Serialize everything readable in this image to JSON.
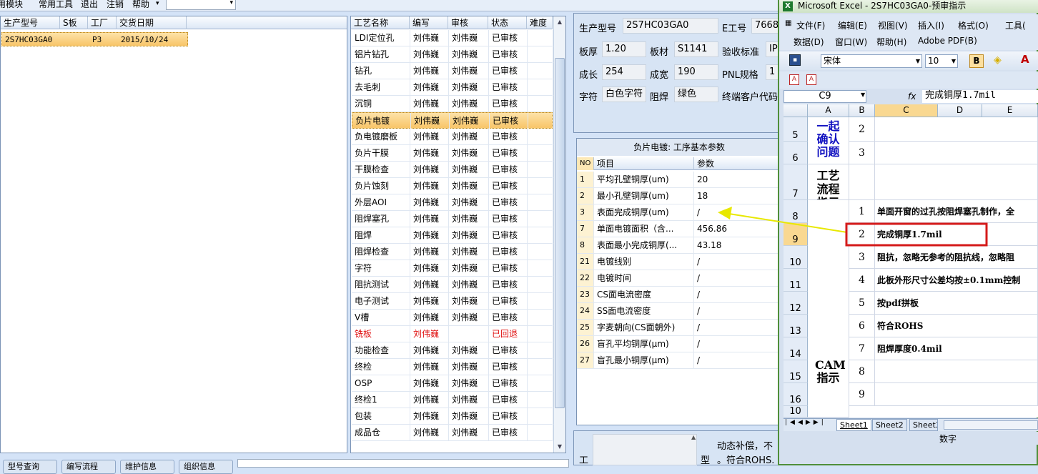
{
  "menu": {
    "items": [
      "共用模块",
      "常用工具",
      "退出",
      "注销",
      "帮助"
    ],
    "dropdown_arrow": "▾"
  },
  "products": {
    "headers": [
      "生产型号",
      "S板",
      "工厂",
      "交货日期"
    ],
    "rows": [
      {
        "model": "2S7HC03GA0",
        "s": "",
        "factory": "P3",
        "date": "2015/10/24"
      }
    ]
  },
  "process": {
    "headers": [
      "工艺名称",
      "编写",
      "审核",
      "状态",
      "难度"
    ],
    "rows": [
      {
        "name": "LDI定位孔",
        "writer": "刘伟巍",
        "reviewer": "刘伟巍",
        "status": "已审核"
      },
      {
        "name": "铝片钻孔",
        "writer": "刘伟巍",
        "reviewer": "刘伟巍",
        "status": "已审核"
      },
      {
        "name": "钻孔",
        "writer": "刘伟巍",
        "reviewer": "刘伟巍",
        "status": "已审核"
      },
      {
        "name": "去毛刺",
        "writer": "刘伟巍",
        "reviewer": "刘伟巍",
        "status": "已审核"
      },
      {
        "name": "沉铜",
        "writer": "刘伟巍",
        "reviewer": "刘伟巍",
        "status": "已审核"
      },
      {
        "name": "负片电镀",
        "writer": "刘伟巍",
        "reviewer": "刘伟巍",
        "status": "已审核"
      },
      {
        "name": "负电镀磨板",
        "writer": "刘伟巍",
        "reviewer": "刘伟巍",
        "status": "已审核"
      },
      {
        "name": "负片干膜",
        "writer": "刘伟巍",
        "reviewer": "刘伟巍",
        "status": "已审核"
      },
      {
        "name": "干膜检查",
        "writer": "刘伟巍",
        "reviewer": "刘伟巍",
        "status": "已审核"
      },
      {
        "name": "负片蚀刻",
        "writer": "刘伟巍",
        "reviewer": "刘伟巍",
        "status": "已审核"
      },
      {
        "name": "外层AOI",
        "writer": "刘伟巍",
        "reviewer": "刘伟巍",
        "status": "已审核"
      },
      {
        "name": "阻焊塞孔",
        "writer": "刘伟巍",
        "reviewer": "刘伟巍",
        "status": "已审核"
      },
      {
        "name": "阻焊",
        "writer": "刘伟巍",
        "reviewer": "刘伟巍",
        "status": "已审核"
      },
      {
        "name": "阻焊检查",
        "writer": "刘伟巍",
        "reviewer": "刘伟巍",
        "status": "已审核"
      },
      {
        "name": "字符",
        "writer": "刘伟巍",
        "reviewer": "刘伟巍",
        "status": "已审核"
      },
      {
        "name": "阻抗测试",
        "writer": "刘伟巍",
        "reviewer": "刘伟巍",
        "status": "已审核"
      },
      {
        "name": "电子测试",
        "writer": "刘伟巍",
        "reviewer": "刘伟巍",
        "status": "已审核"
      },
      {
        "name": "V槽",
        "writer": "刘伟巍",
        "reviewer": "刘伟巍",
        "status": "已审核"
      },
      {
        "name": "铣板",
        "writer": "刘伟巍",
        "reviewer": "",
        "status": "已回退"
      },
      {
        "name": "功能检查",
        "writer": "刘伟巍",
        "reviewer": "刘伟巍",
        "status": "已审核"
      },
      {
        "name": "终检",
        "writer": "刘伟巍",
        "reviewer": "刘伟巍",
        "status": "已审核"
      },
      {
        "name": "OSP",
        "writer": "刘伟巍",
        "reviewer": "刘伟巍",
        "status": "已审核"
      },
      {
        "name": "终检1",
        "writer": "刘伟巍",
        "reviewer": "刘伟巍",
        "status": "已审核"
      },
      {
        "name": "包装",
        "writer": "刘伟巍",
        "reviewer": "刘伟巍",
        "status": "已审核"
      },
      {
        "name": "成品仓",
        "writer": "刘伟巍",
        "reviewer": "刘伟巍",
        "status": "已审核"
      }
    ]
  },
  "info": {
    "model_label": "生产型号",
    "model_value": "2S7HC03GA0",
    "eno_label": "E工号",
    "eno_value": "7668",
    "thickness_label": "板厚",
    "thickness_value": "1.20",
    "material_label": "板材",
    "material_value": "S1141",
    "standard_label": "验收标准",
    "standard_value": "IP",
    "length_label": "成长",
    "length_value": "254",
    "width_label": "成宽",
    "width_value": "190",
    "pnl_label": "PNL规格",
    "pnl_value": "1",
    "char_label": "字符",
    "char_value": "白色字符",
    "mask_label": "阻焊",
    "mask_value": "绿色",
    "customer_label": "终端客户代码"
  },
  "params": {
    "title": "负片电镀: 工序基本参数",
    "headers": [
      "NO",
      "项目",
      "参数"
    ],
    "rows": [
      {
        "no": "1",
        "item": "平均孔壁铜厚(um)",
        "value": "20"
      },
      {
        "no": "2",
        "item": "最小孔壁铜厚(um)",
        "value": "18"
      },
      {
        "no": "3",
        "item": "表面完成铜厚(um)",
        "value": "/"
      },
      {
        "no": "7",
        "item": "单面电镀面积（含...",
        "value": "456.86"
      },
      {
        "no": "8",
        "item": "表面最小完成铜厚(...",
        "value": "43.18"
      },
      {
        "no": "21",
        "item": "电镀线别",
        "value": "/"
      },
      {
        "no": "22",
        "item": "电镀时间",
        "value": "/"
      },
      {
        "no": "23",
        "item": "CS面电流密度",
        "value": "/"
      },
      {
        "no": "24",
        "item": "SS面电流密度",
        "value": "/"
      },
      {
        "no": "25",
        "item": "字麦朝向(CS面朝外)",
        "value": "/"
      },
      {
        "no": "26",
        "item": "盲孔平均铜厚(μm)",
        "value": "/"
      },
      {
        "no": "27",
        "item": "盲孔最小铜厚(μm)",
        "value": "/"
      }
    ]
  },
  "bottom_right": {
    "left_label": "工",
    "type_label": "型",
    "note_line1": "动态补偿，不",
    "note_line2": "。符合ROHS."
  },
  "bottom_tabs": [
    "型号查询",
    "编写流程",
    "维护信息",
    "组织信息"
  ],
  "excel": {
    "title": "Microsoft Excel - 2S7HC03GA0-预审指示",
    "menu_row1": [
      "文件(F)",
      "编辑(E)",
      "视图(V)",
      "插入(I)",
      "格式(O)",
      "工具("
    ],
    "menu_row2": [
      "数据(D)",
      "窗口(W)",
      "帮助(H)",
      "Adobe PDF(B)"
    ],
    "font_name": "宋体",
    "font_size": "10",
    "bold_label": "B",
    "name_box": "C9",
    "fx": "fx",
    "formula": "完成铜厚1.7mil",
    "col_headers": [
      "A",
      "B",
      "C",
      "D",
      "E"
    ],
    "row_numbers": [
      "5",
      "6",
      "7",
      "8",
      "9",
      "10",
      "11",
      "12",
      "13",
      "14",
      "15",
      "16",
      "10"
    ],
    "merged_a1": "一起确认问题",
    "merged_a2": "工艺流程指示",
    "merged_a3": "CAM指示",
    "b_values": [
      "2",
      "3",
      "",
      "1",
      "2",
      "3",
      "4",
      "5",
      "6",
      "7",
      "8",
      "9"
    ],
    "c_values": [
      "",
      "",
      "",
      "单面开窗的过孔按阻焊塞孔制作，全",
      "完成铜厚1.7mil",
      "阻抗，忽略无参考的阻抗线，忽略阻",
      "此板外形尺寸公差均按±0.1mm控制",
      "按pdf拼板",
      "符合ROHS",
      "阻焊厚度0.4mil",
      "",
      ""
    ],
    "sheets": [
      "Sheet1",
      "Sheet2",
      "Sheet3"
    ],
    "status": "数字"
  },
  "colors": {
    "arrow": "#e8e800",
    "highlight_box": "#d41a1a",
    "selected_row": "#f8c568",
    "reverted": "#e01010"
  }
}
